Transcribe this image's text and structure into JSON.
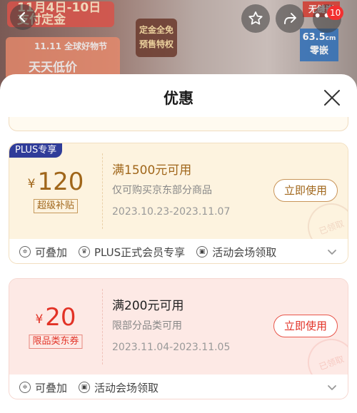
{
  "backdrop": {
    "banner_line1": "11月4日-10日",
    "banner_line2": "支付定金",
    "sale_text1": "11.11 全球好物节",
    "sale_text2": "天天低价",
    "tag_line1": "定金全免",
    "tag_line2": "预售特权",
    "size_value": "63.5",
    "size_unit": "cm",
    "size_label": "零嵌",
    "red_label": "无缝嵌",
    "badge_count": "10"
  },
  "sheet": {
    "title": "优惠"
  },
  "coupons": [
    {
      "label": "PLUS专享",
      "currency": "¥",
      "amount": "120",
      "type_tag": "超级补贴",
      "condition": "满1500元可用",
      "scope": "仅可购买京东部分商品",
      "dates": "2023.10.23-2023.11.07",
      "action": "立即使用",
      "stamp": "已领取",
      "features": [
        "可叠加",
        "PLUS正式会员专享",
        "活动会场领取"
      ]
    },
    {
      "currency": "¥",
      "amount": "20",
      "type_tag": "限品类东券",
      "condition": "满200元可用",
      "scope": "限部分品类可用",
      "dates": "2023.11.04-2023.11.05",
      "action": "立即使用",
      "stamp": "已领取",
      "features": [
        "可叠加",
        "活动会场领取"
      ]
    }
  ],
  "colors": {
    "gold_accent": "#a0661a",
    "red_accent": "#e23226",
    "plus_badge": "#2f3c99"
  }
}
